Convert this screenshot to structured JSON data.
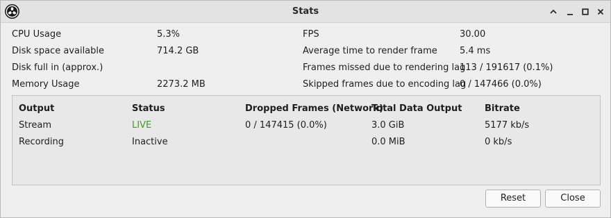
{
  "window": {
    "title": "Stats",
    "icons": [
      "obs-logo-icon",
      "shade-icon",
      "minimize-icon",
      "maximize-icon",
      "close-icon"
    ]
  },
  "stats": {
    "left": [
      {
        "label": "CPU Usage",
        "value": "5.3%"
      },
      {
        "label": "Disk space available",
        "value": "714.2 GB"
      },
      {
        "label": "Disk full in (approx.)",
        "value": ""
      },
      {
        "label": "Memory Usage",
        "value": "2273.2 MB"
      }
    ],
    "right": [
      {
        "label": "FPS",
        "value": "30.00"
      },
      {
        "label": "Average time to render frame",
        "value": "5.4 ms"
      },
      {
        "label": "Frames missed due to rendering lag",
        "value": "113 / 191617 (0.1%)"
      },
      {
        "label": "Skipped frames due to encoding lag",
        "value": "0 / 147466 (0.0%)"
      }
    ]
  },
  "outputs": {
    "headers": [
      "Output",
      "Status",
      "Dropped Frames (Network)",
      "Total Data Output",
      "Bitrate"
    ],
    "rows": [
      [
        "Stream",
        "LIVE",
        "0 / 147415 (0.0%)",
        "3.0 GiB",
        "5177 kb/s"
      ],
      [
        "Recording",
        "Inactive",
        "",
        "0.0 MiB",
        "0 kb/s"
      ]
    ],
    "live_color": "#3f9a2a"
  },
  "buttons": {
    "reset": "Reset",
    "close": "Close"
  }
}
